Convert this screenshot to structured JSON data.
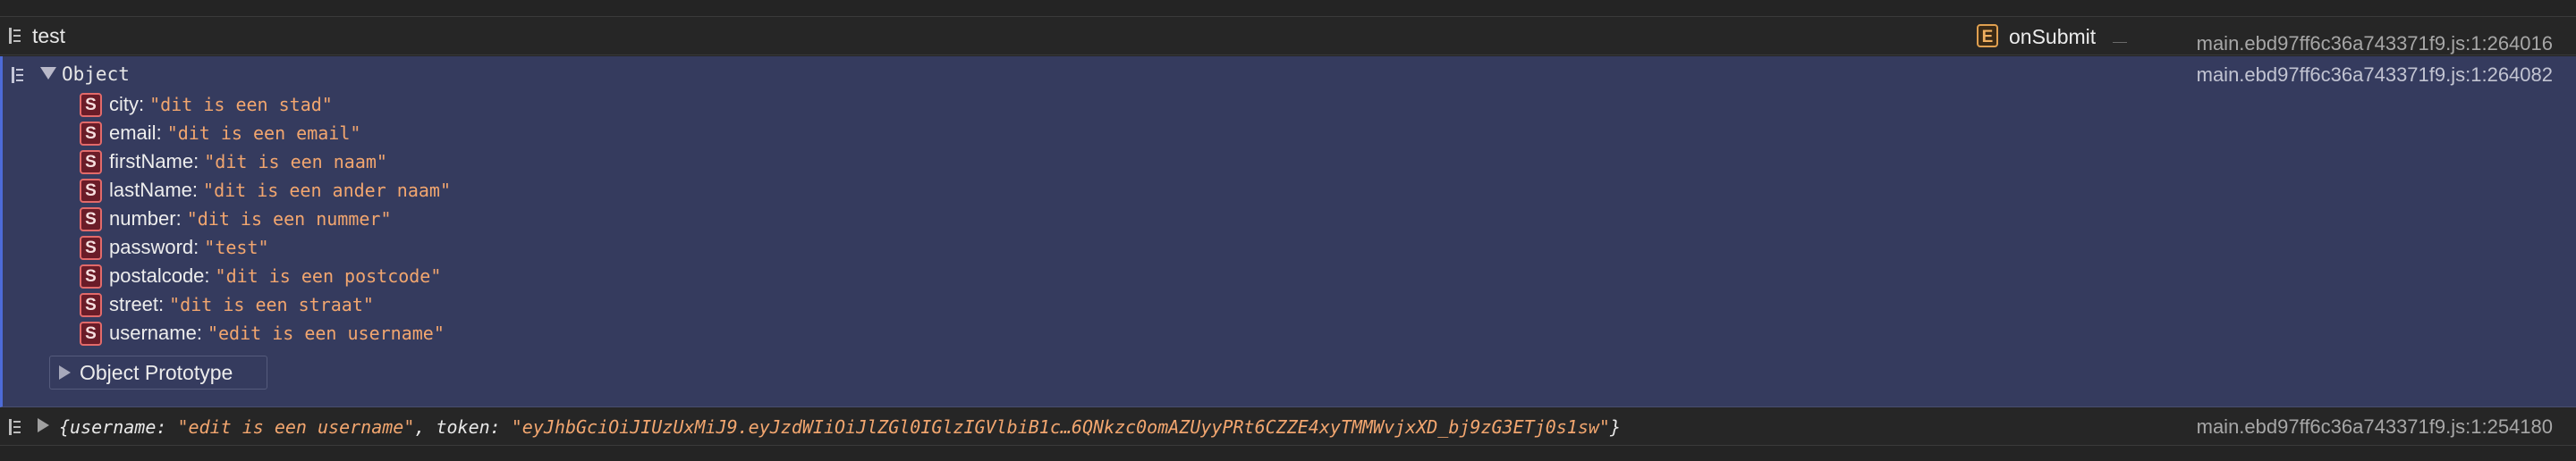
{
  "log_row": {
    "message": "test",
    "function_badge": "E",
    "function_name": "onSubmit",
    "source": "main.ebd97ff6c36a743371f9.js:1:264016"
  },
  "object_row": {
    "title": "Object",
    "source": "main.ebd97ff6c36a743371f9.js:1:264082",
    "type_badge": "S",
    "properties": [
      {
        "key": "city:",
        "value": "\"dit is een stad\""
      },
      {
        "key": "email:",
        "value": "\"dit is een email\""
      },
      {
        "key": "firstName:",
        "value": "\"dit is een naam\""
      },
      {
        "key": "lastName:",
        "value": "\"dit is een ander naam\""
      },
      {
        "key": "number:",
        "value": "\"dit is een nummer\""
      },
      {
        "key": "password:",
        "value": "\"test\""
      },
      {
        "key": "postalcode:",
        "value": "\"dit is een postcode\""
      },
      {
        "key": "street:",
        "value": "\"dit is een straat\""
      },
      {
        "key": "username:",
        "value": "\"edit is een username\""
      }
    ],
    "prototype_label": "Object Prototype"
  },
  "result_row": {
    "open_brace": "{",
    "key1": "username:",
    "value1": "\"edit is een username\"",
    "sep": ", ",
    "key2": "token:",
    "value2": "\"eyJhbGciOiJIUzUxMiJ9.eyJzdWIiOiJlZGl0IGlzIGVlbiB1c…6QNkzc0omAZUyyPRt6CZZE4xyTMMWvjxXD_bj9zG3ETj0s1sw\"",
    "close_brace": "}",
    "source": "main.ebd97ff6c36a743371f9.js:1:254180"
  },
  "colors": {
    "object_background": "#353b5e",
    "string_value": "#f2a66f",
    "string_badge": "#6a1c28",
    "function_badge": "#e0a050"
  },
  "icons": [
    "log-entry-icon",
    "expand-triangle-icon",
    "collapse-triangle-icon"
  ]
}
